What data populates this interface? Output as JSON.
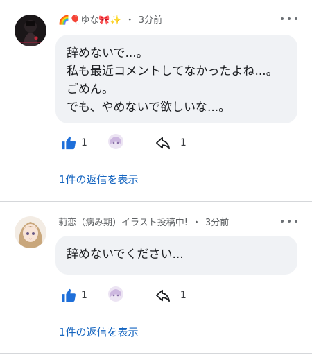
{
  "comments": [
    {
      "author": "🌈🎈ゆな🎀✨",
      "time": "3分前",
      "dot": "・",
      "text": "辞めないで...。\n私も最近コメントしてなかったよね...。ごめん。\nでも、やめないで欲しいな...。",
      "likes": "1",
      "replies_count": "1",
      "reply_link": "1件の返信を表示"
    },
    {
      "author": "莉恋（病み期）イラスト投稿中!",
      "time": "3分前",
      "dot": "・",
      "text": "辞めないでください...",
      "likes": "1",
      "replies_count": "1",
      "reply_link": "1件の返信を表示"
    }
  ],
  "colors": {
    "like_blue": "#1e6fd9",
    "link_blue": "#1565c0",
    "bubble_bg": "#f0f2f5"
  },
  "icons": [
    "more-icon",
    "thumbs-up-icon",
    "sticker-icon",
    "reply-arrow-icon"
  ]
}
